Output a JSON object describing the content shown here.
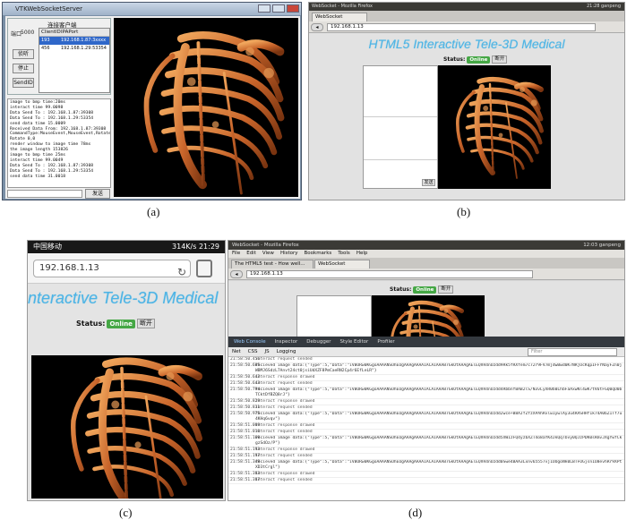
{
  "panel_a": {
    "window_title": "VTKWebSocketServer",
    "group_label": "连接客户端",
    "port_label": "端口",
    "port_value": "5000",
    "listen_label": "侦听",
    "stop_label": "停止",
    "send_label": "SendID",
    "headers": [
      "ClientID",
      "IPAPort"
    ],
    "clients": [
      [
        "193",
        "192.168.1.87:3xxxx"
      ],
      [
        "456",
        "192.168.1.29:53354"
      ]
    ],
    "log": [
      "image to bmp time:20ms",
      "interact time 99.0098",
      "Data Send To : 192.168.1.87:39308",
      "Data Send To : 192.168.1.29:53354",
      "send data time 15.0009",
      "Received Data From: 192.168.1.87:39308",
      "CommandType:MouseEvent,MouseEvent,Rotate,\"1",
      "Rotate 0,0",
      "render window to image time 78ms",
      "the image length 153826",
      "image to bmp time 25ms",
      "interact time 99.0049",
      "Data Send To : 192.168.1.87:39308",
      "Data Send To : 192.168.1.29:53354",
      "send data time 31.0018"
    ],
    "send_button": "发送",
    "caption": "(a)"
  },
  "panel_b": {
    "os_bar": "WebSocket - Mozilla Firefox",
    "os_right": "21:28  ganpeng",
    "tab": "WebSocket",
    "url": "192.168.1.13",
    "title": "HTML5 Interactive Tele-3D Medical",
    "status_label": "Status:",
    "online": "Online",
    "disconnect": "断开",
    "send": "发送",
    "caption": "(b)"
  },
  "panel_c": {
    "carrier": "中国移动",
    "status_right": "314K/s  21:29",
    "url": "192.168.1.13",
    "title": "nteractive Tele-3D Medical",
    "status_label": "Status:",
    "online": "Online",
    "disconnect": "断开",
    "caption": "(c)"
  },
  "panel_d": {
    "window_title": "WebSocket - Mozilla Firefox",
    "menu": [
      "File",
      "Edit",
      "View",
      "History",
      "Bookmarks",
      "Tools",
      "Help"
    ],
    "tabs": [
      "The HTML5 test - How well...",
      "WebSocket"
    ],
    "url": "192.168.1.13",
    "os_right": "12:03  ganpeng",
    "status_label": "Status:",
    "online": "Online",
    "disconnect": "断开",
    "tools": [
      "Web Console",
      "Inspector",
      "Debugger",
      "Style Editor",
      "Profiler"
    ],
    "filters": [
      "Net",
      "CSS",
      "JS",
      "Logging"
    ],
    "filter_placeholder": "Filter",
    "logs": [
      [
        "21:58:50.456",
        "interact request sended",
        false
      ],
      [
        "21:58:50.605",
        "recieved image data:{\"Type\":5,\"Data\":\"iVBORw0KGgoAAAANSUhEUgAAAgAAAAIACAIAAAB7GkOtAAAgAElEQVR4nOzdd9Rk5fRXfem7c72r9FV7mjdwBwd0K7NRjUcKqpIFFYNayFZn0jWBMJ6SdzL7Anvt24ct0jsiUdXZF8PmCaeRN2Cp4r6EfLeLR\"}",
        true
      ],
      [
        "21:58:50.642",
        "interact response drawed",
        false
      ],
      [
        "21:58:50.643",
        "interact request sended",
        false
      ],
      [
        "21:58:50.794",
        "recieved image data:{\"Type\":5,\"Data\":\"iVBORw0KGgoAAAANSUhEUgAAAgAAAAIACAIAAAB7GkOtAAAgAElEQVR4nOzdd4RbbnfBAB2lS/N3vLyXR0b0LhbFaAxwNl4wK7tV6tFGQ0qU0bTCktDfBZQ8rJ\"}",
        true
      ],
      [
        "21:58:50.829",
        "interact response drawed",
        false
      ],
      [
        "21:58:50.831",
        "interact request sended",
        false
      ],
      [
        "21:58:50.975",
        "recieved image data:{\"Type\":5,\"Data\":\"iVBORw0KGgoAAAANSUhEUgAAAgAAAAIACAIAAAB7GkOtAAAgAElEQVR4nOzdd2wce+B8AJfZfzXPAhRvlw1ywlAy3u4RASHHf1k74A06Z1Tf7u4KHq6vqv\"}",
        true
      ],
      [
        "21:58:51.009",
        "interact response drawed",
        false
      ],
      [
        "21:58:51.010",
        "interact request sended",
        false
      ],
      [
        "21:58:51.160",
        "recieved image data:{\"Type\":5,\"Data\":\"iVBORw0KGgoAAAANSUhEUgAAAgAAAAIACAIAAAB7GkOtAAAgAElEQVR4nOzdd5XW1zFQ4yzbXZT4o8aYK4JkQqTbvy0QJzPDK0sRmvJXgYwfCkgzSdOz/P\"}",
        true
      ],
      [
        "21:58:51.193",
        "interact response drawed",
        false
      ],
      [
        "21:58:51.197",
        "interact request sended",
        false
      ],
      [
        "21:58:51.348",
        "recieved image data:{\"Type\":5,\"Data\":\"iVBORw0KGgoAAAANSUhEUgAAAgAAAAIACAIAAAB7GkOtAAAgAElEQVR4nOzdd0Swe4BAA3Lxnv65557vj1UOgoNk0LBTFOGjsn1U8evhRr9XPtXD3tCrgl\"}",
        true
      ],
      [
        "21:58:51.383",
        "interact response drawed",
        false
      ],
      [
        "21:58:51.387",
        "interact request sended",
        false
      ]
    ],
    "caption": "(d)"
  },
  "colors": {
    "bone": "#c8642a",
    "bone_light": "#e79a55",
    "online": "#45a745",
    "title": "#4db3e6"
  }
}
